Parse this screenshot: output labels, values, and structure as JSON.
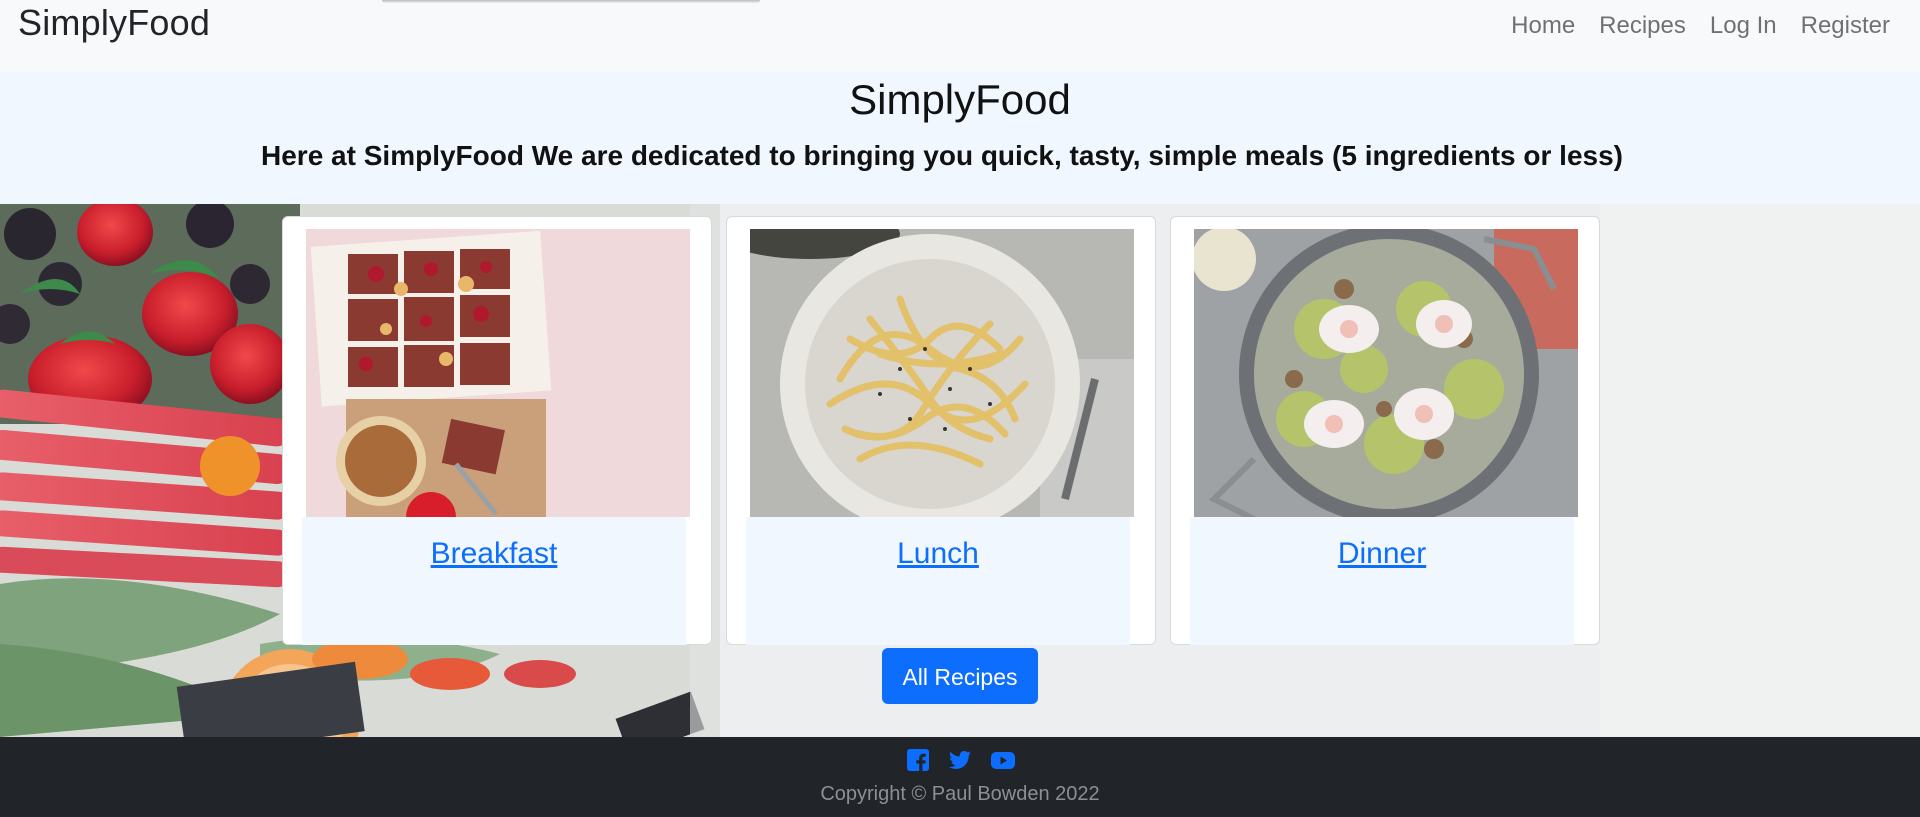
{
  "navbar": {
    "brand": "SimplyFood",
    "links": [
      "Home",
      "Recipes",
      "Log In",
      "Register"
    ]
  },
  "hero": {
    "title": "SimplyFood",
    "tagline": "Here at SimplyFood We are dedicated to bringing you quick, tasty, simple meals (5 ingredients or less)"
  },
  "cards": [
    {
      "label": "Breakfast",
      "image": "breakfast-bars-image"
    },
    {
      "label": "Lunch",
      "image": "spaghetti-bowl-image"
    },
    {
      "label": "Dinner",
      "image": "egg-skillet-image"
    }
  ],
  "all_recipes_button": "All Recipes",
  "footer": {
    "icons": [
      "facebook-icon",
      "twitter-icon",
      "youtube-icon"
    ],
    "copyright": "Copyright © Paul Bowden 2022"
  },
  "colors": {
    "accent": "#0d6efd",
    "hero_bg": "#f0f7ff",
    "footer_bg": "#212529",
    "navbar_bg": "#f8f9fa"
  }
}
